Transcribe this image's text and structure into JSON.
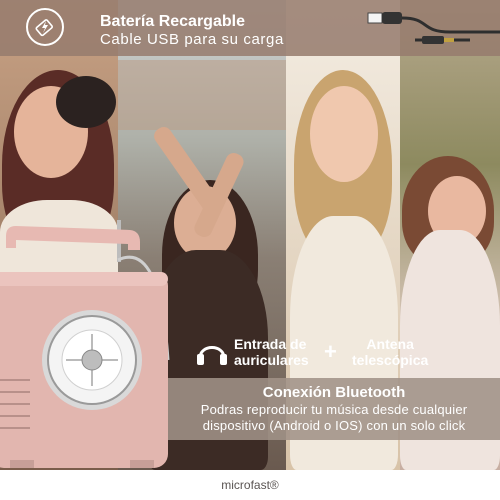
{
  "banner": {
    "title": "Batería Recargable",
    "subtitle": "Cable USB para su carga",
    "icon": "battery-charging-icon"
  },
  "features": {
    "headphone": {
      "icon": "headphones-icon",
      "line1": "Entrada de",
      "line2": "auriculares"
    },
    "plus": "+",
    "antenna": {
      "line1": "Antena",
      "line2": "telescópica"
    }
  },
  "bluetooth": {
    "title": "Conexión Bluetooth",
    "line1": "Podras reproducir tu música desde cualquier",
    "line2": "dispositivo (Android o IOS) con un solo click"
  },
  "footer": {
    "brand": "microfast®"
  },
  "colors": {
    "banner": "#967c6e",
    "radio_pink": "#e2b7b0",
    "text": "#ffffff"
  }
}
